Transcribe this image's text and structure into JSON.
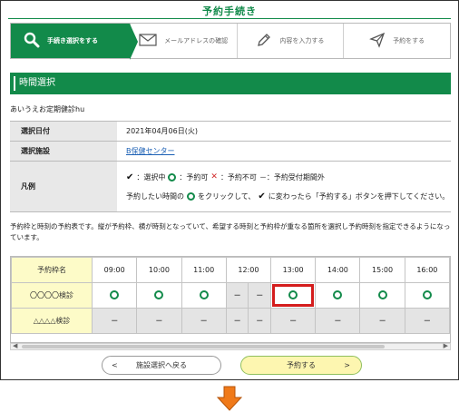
{
  "page_title": "予約手続き",
  "steps": [
    {
      "label": "手続き選択をする",
      "icon": "search-icon",
      "active": true
    },
    {
      "label": "メールアドレスの確認",
      "icon": "mail-icon",
      "active": false
    },
    {
      "label": "内容を入力する",
      "icon": "pencil-icon",
      "active": false
    },
    {
      "label": "予約をする",
      "icon": "send-icon",
      "active": false
    }
  ],
  "section_title": "時間選択",
  "exam_name": "あいうえお定期健診hu",
  "info": {
    "date_label": "選択日付",
    "date_value": "2021年04月06日(火)",
    "facility_label": "選択施設",
    "facility_value": "B保健センター",
    "legend_label": "凡例",
    "legend_selected": "：選択中",
    "legend_available": "：予約可",
    "legend_unavailable": "：予約不可",
    "legend_outside": "－：予約受付期間外",
    "legend_instruction_1": "予約したい時間の",
    "legend_instruction_2": "をクリックして、",
    "legend_instruction_3": "に変わったら「予約する」ボタンを押下してください。"
  },
  "description": "予約枠と時刻の予約表です。縦が予約枠、横が時刻となっていて、希望する時刻と予約枠が重なる箇所を選択し予約時刻を指定できるようになっています。",
  "schedule": {
    "header_label": "予約枠名",
    "times": [
      "09:00",
      "10:00",
      "11:00",
      "12:00",
      "13:00",
      "14:00",
      "15:00",
      "16:00"
    ],
    "rows": [
      {
        "name": "〇〇〇〇検診",
        "cells": [
          "○",
          "○",
          "○",
          "－",
          "－",
          "○",
          "○",
          "○",
          "○"
        ]
      },
      {
        "name": "△△△△検診",
        "cells": [
          "－",
          "－",
          "－",
          "－",
          "－",
          "－",
          "－",
          "－",
          "－"
        ]
      }
    ],
    "selected": {
      "row": 0,
      "time": "13:00"
    }
  },
  "buttons": {
    "back_label": "施設選択へ戻る",
    "back_arrow": "<",
    "next_label": "予約する",
    "next_arrow": ">"
  },
  "colors": {
    "brand_green": "#128a4a",
    "selection_red": "#d41d1d",
    "slot_name_bg": "#fdfbc8",
    "next_button_bg": "#fdf6b0",
    "arrow_orange": "#f07a1a"
  }
}
